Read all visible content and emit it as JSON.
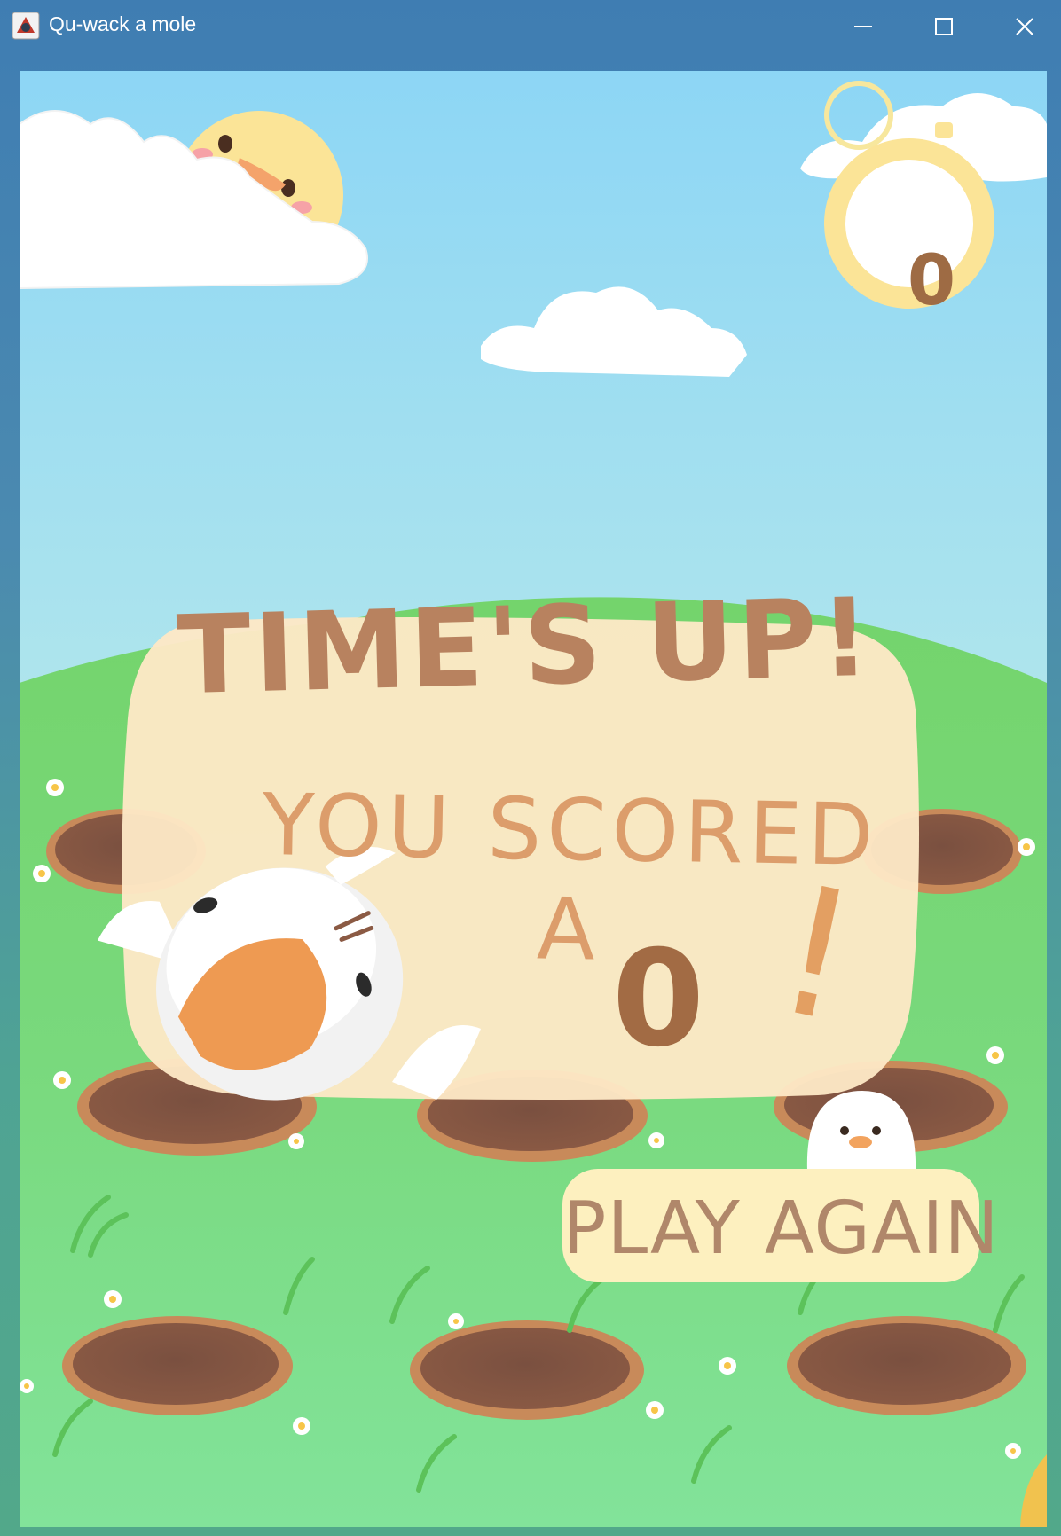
{
  "window": {
    "title": "Qu-wack a mole",
    "controls": {
      "minimize": "minimize-icon",
      "maximize": "maximize-icon",
      "close": "close-icon"
    }
  },
  "game": {
    "timer": "0",
    "heading": "TIME'S UP!",
    "scored_label": "YOU SCORED A",
    "score": "0",
    "exclaim": "!",
    "play_again_label": "PLAY AGAIN"
  },
  "colors": {
    "titlebar": "#3f7eb3",
    "sky_top": "#8dd6f5",
    "grass": "#7ede80",
    "panel": "#fde8c6",
    "heading": "#b8825f",
    "scored_text": "#dc9d6b",
    "score": "#a26b44",
    "button": "#fdf0bf",
    "sun": "#fbe497"
  }
}
